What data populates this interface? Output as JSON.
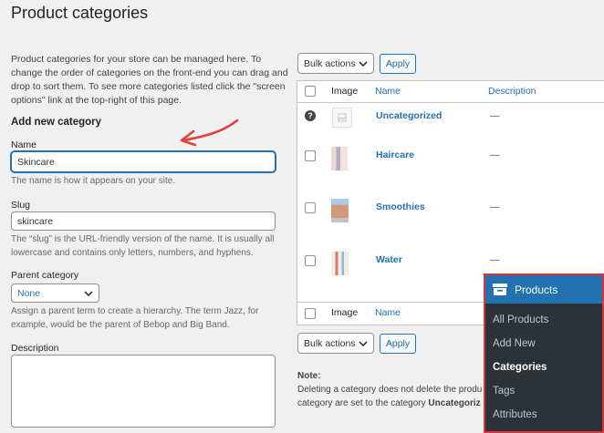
{
  "page": {
    "title": "Product categories"
  },
  "form": {
    "intro": "Product categories for your store can be managed here. To change the order of categories on the front-end you can drag and drop to sort them. To see more categories listed click the \"screen options\" link at the top-right of this page.",
    "section_title": "Add new category",
    "name_label": "Name",
    "name_value": "Skincare",
    "name_help": "The name is how it appears on your site.",
    "slug_label": "Slug",
    "slug_value": "skincare",
    "slug_help": "The “slug” is the URL-friendly version of the name. It is usually all lowercase and contains only letters, numbers, and hyphens.",
    "parent_label": "Parent category",
    "parent_value": "None",
    "parent_help": "Assign a parent term to create a hierarchy. The term Jazz, for example, would be the parent of Bebop and Big Band.",
    "description_label": "Description",
    "description_value": ""
  },
  "bulk": {
    "select_label": "Bulk actions",
    "apply_label": "Apply"
  },
  "table": {
    "headers": {
      "image": "Image",
      "name": "Name",
      "description": "Description"
    },
    "rows": [
      {
        "name": "Uncategorized",
        "description": "—",
        "thumb": "placeholder"
      },
      {
        "name": "Haircare",
        "description": "—",
        "thumb": "haircare"
      },
      {
        "name": "Smoothies",
        "description": "—",
        "thumb": "smoothies"
      },
      {
        "name": "Water",
        "description": "—",
        "thumb": "water"
      }
    ]
  },
  "note": {
    "title": "Note:",
    "text_line1": "Deleting a category does not delete the produ",
    "text_line2_prefix": "category are set to the category ",
    "text_line2_bold": "Uncategoriz"
  },
  "menu": {
    "title": "Products",
    "items": [
      {
        "label": "All Products",
        "active": false
      },
      {
        "label": "Add New",
        "active": false
      },
      {
        "label": "Categories",
        "active": true
      },
      {
        "label": "Tags",
        "active": false
      },
      {
        "label": "Attributes",
        "active": false
      }
    ]
  },
  "colors": {
    "accent": "#2271b1",
    "highlight_border": "#d63638",
    "arrow": "#e2403a",
    "menu_bg": "#2c3338"
  },
  "icons": [
    "help-icon",
    "image-placeholder-icon",
    "chevron-down-icon",
    "archive-box-icon",
    "red-arrow-annotation"
  ]
}
